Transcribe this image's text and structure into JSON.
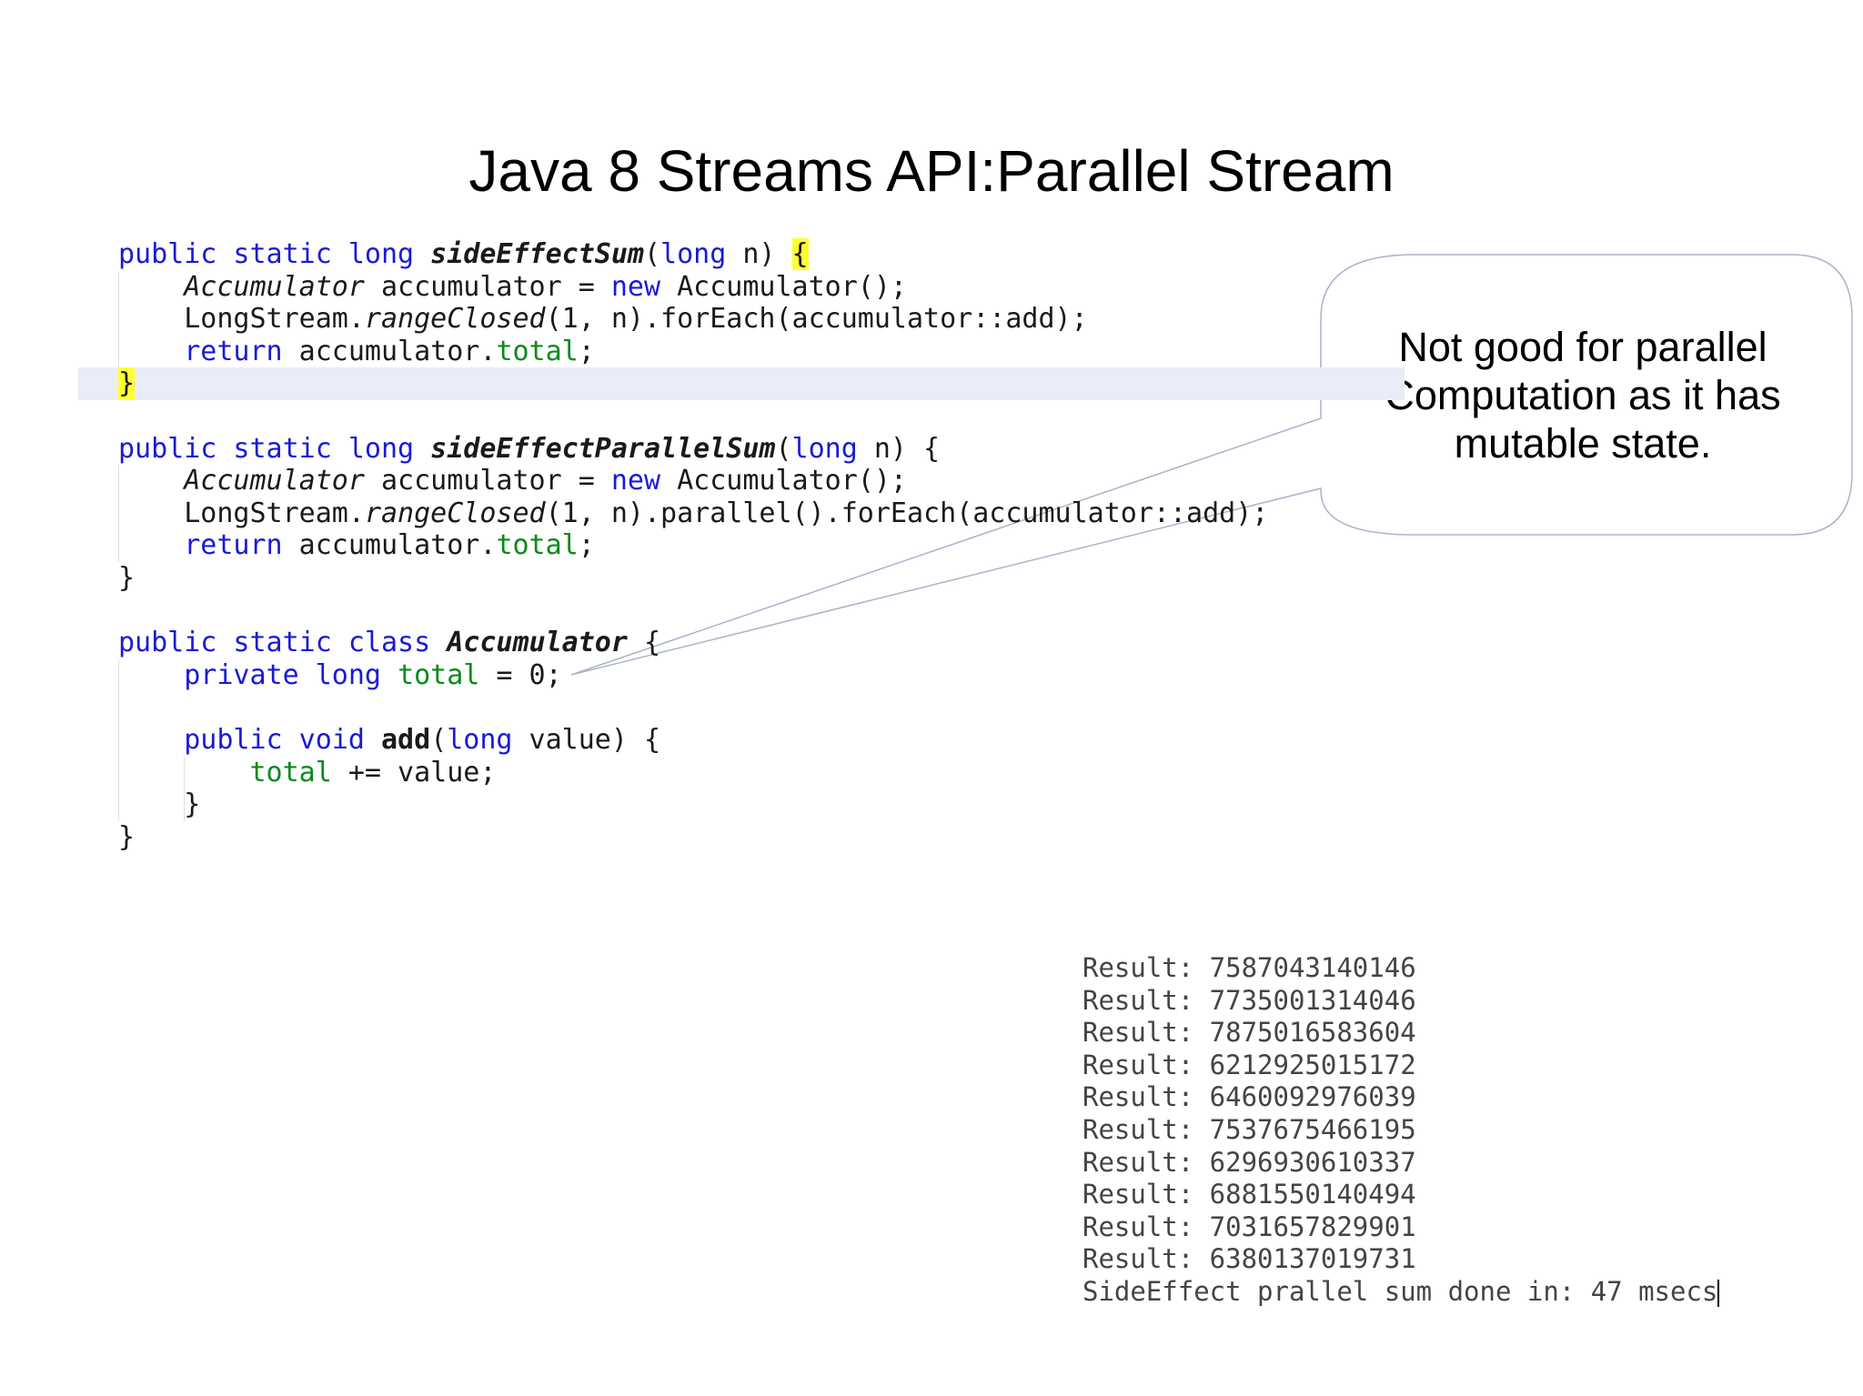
{
  "title": "Java 8 Streams API:Parallel Stream",
  "code": {
    "m1_sig_kw": "public static long",
    "m1_name": "sideEffectSum",
    "m1_param_open": "(",
    "m1_param_type": "long",
    "m1_param_rest": " n) ",
    "m1_brace_open": "{",
    "acc_type": "Accumulator",
    "acc_decl": " accumulator = ",
    "new_kw": "new",
    "acc_ctor": " Accumulator();",
    "ls_class": "LongStream.",
    "range_method": "rangeClosed",
    "m1_stream_rest": "(1, n).forEach(accumulator::add);",
    "return_kw": "return",
    "return_obj": " accumulator.",
    "total_field": "total",
    "semicolon": ";",
    "brace_close": "}",
    "m2_sig_kw": "public static long",
    "m2_name": "sideEffectParallelSum",
    "m2_param_rest": " n) {",
    "m2_stream_rest": "(1, n).parallel().forEach(accumulator::add);",
    "class_sig_kw": "public static class",
    "class_name": "Accumulator",
    "class_brace": " {",
    "field_kw": "private long",
    "field_rest": " = 0;",
    "add_kw": "public void",
    "add_name": "add",
    "add_param_rest": " value) {",
    "add_body_rest": " += value;"
  },
  "callout": {
    "text": "Not good for parallel Computation as it has mutable state."
  },
  "console": {
    "lines": [
      "Result: 7587043140146",
      "Result: 7735001314046",
      "Result: 7875016583604",
      "Result: 6212925015172",
      "Result: 6460092976039",
      "Result: 7537675466195",
      "Result: 6296930610337",
      "Result: 6881550140494",
      "Result: 7031657829901",
      "Result: 6380137019731",
      "SideEffect prallel sum done in: 47 msecs"
    ]
  }
}
